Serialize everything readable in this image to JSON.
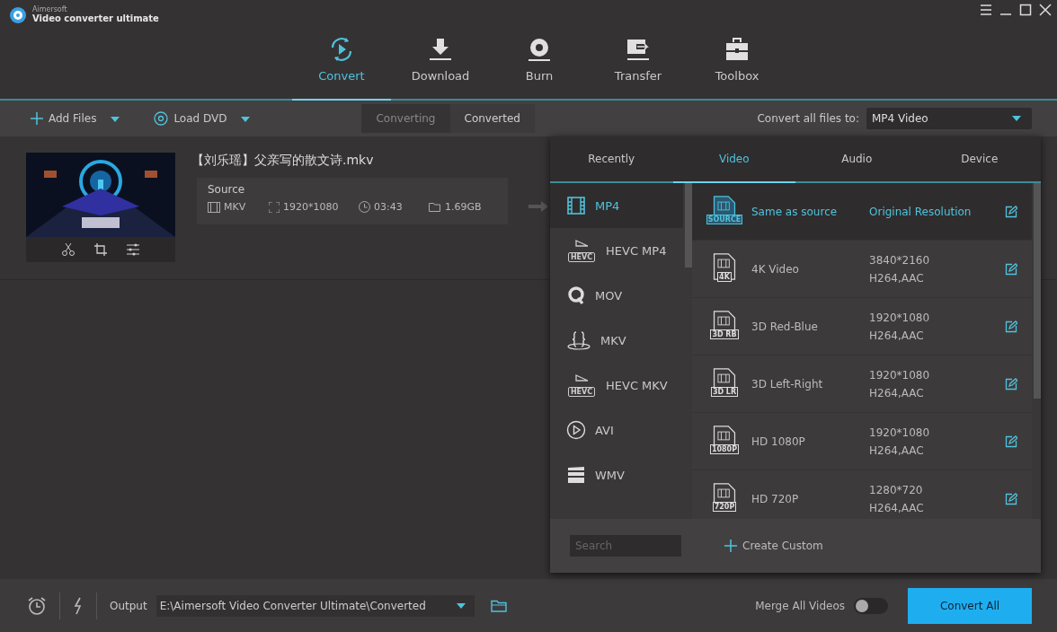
{
  "window": {
    "brand_small": "Aimersoft",
    "brand": "Video converter ultimate"
  },
  "nav": [
    {
      "label": "Convert",
      "kind": "convert",
      "selected": true
    },
    {
      "label": "Download",
      "kind": "download",
      "selected": false
    },
    {
      "label": "Burn",
      "kind": "burn",
      "selected": false
    },
    {
      "label": "Transfer",
      "kind": "transfer",
      "selected": false
    },
    {
      "label": "Toolbox",
      "kind": "toolbox",
      "selected": false
    }
  ],
  "toolbar": {
    "add_files": "Add Files",
    "load_dvd": "Load DVD",
    "view_tabs": [
      {
        "label": "Converting",
        "selected": false
      },
      {
        "label": "Converted",
        "selected": true
      }
    ],
    "convert_all_label": "Convert all files to:",
    "convert_all_value": "MP4 Video"
  },
  "file": {
    "name": "【刘乐瑶】父亲写的散文诗.mkv",
    "source_label": "Source",
    "format": "MKV",
    "resolution": "1920*1080",
    "duration": "03:43",
    "size": "1.69GB"
  },
  "format_panel": {
    "tabs": [
      {
        "label": "Recently",
        "selected": false
      },
      {
        "label": "Video",
        "selected": true
      },
      {
        "label": "Audio",
        "selected": false
      },
      {
        "label": "Device",
        "selected": false
      }
    ],
    "formats": [
      {
        "label": "MP4",
        "kind": "film",
        "selected": true
      },
      {
        "label": "HEVC MP4",
        "kind": "hevc",
        "badge": "HEVC",
        "selected": false
      },
      {
        "label": "MOV",
        "kind": "quicktime",
        "selected": false
      },
      {
        "label": "MKV",
        "kind": "braces",
        "selected": false
      },
      {
        "label": "HEVC MKV",
        "kind": "hevc",
        "badge": "HEVC",
        "selected": false
      },
      {
        "label": "AVI",
        "kind": "play",
        "selected": false
      },
      {
        "label": "WMV",
        "kind": "clapper",
        "selected": false
      }
    ],
    "presets": [
      {
        "name": "Same as source",
        "badge": "SOURCE",
        "lines": [
          "Original Resolution"
        ],
        "selected": true
      },
      {
        "name": "4K Video",
        "badge": "4K",
        "lines": [
          "3840*2160",
          "H264,AAC"
        ],
        "selected": false
      },
      {
        "name": "3D Red-Blue",
        "badge": "3D RB",
        "lines": [
          "1920*1080",
          "H264,AAC"
        ],
        "selected": false
      },
      {
        "name": "3D Left-Right",
        "badge": "3D LR",
        "lines": [
          "1920*1080",
          "H264,AAC"
        ],
        "selected": false
      },
      {
        "name": "HD 1080P",
        "badge": "1080P",
        "lines": [
          "1920*1080",
          "H264,AAC"
        ],
        "selected": false
      },
      {
        "name": "HD 720P",
        "badge": "720P",
        "lines": [
          "1280*720",
          "H264,AAC"
        ],
        "selected": false
      }
    ],
    "search": {
      "placeholder": "Search"
    },
    "create_custom": "Create Custom"
  },
  "bottom": {
    "output_label": "Output",
    "output_path": "E:\\Aimersoft Video Converter Ultimate\\Converted",
    "merge_label": "Merge All Videos",
    "merge_on": false,
    "convert_button": "Convert All"
  }
}
